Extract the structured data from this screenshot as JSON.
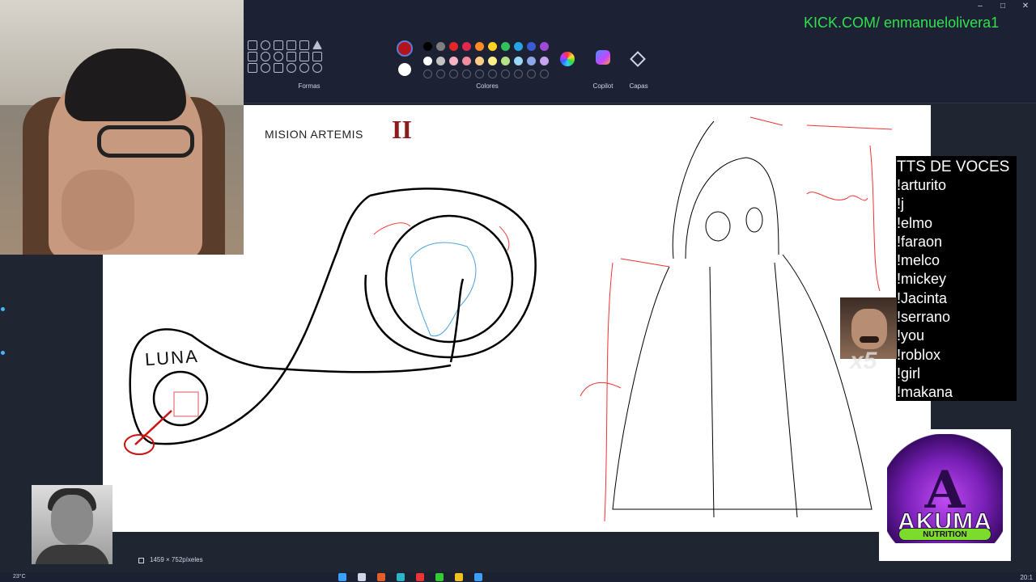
{
  "ribbon": {
    "groups": {
      "shapes_label": "Formas",
      "colors_label": "Colores",
      "copilot_label": "Copilot",
      "layers_label": "Capas"
    },
    "current_color": "#b3141c",
    "secondary_color": "#ffffff",
    "palette_row1": [
      "#000000",
      "#7f7f7f",
      "#e4262b",
      "#e3264f",
      "#ff8a26",
      "#ffd21f",
      "#33c15a",
      "#27a4e3",
      "#3b5bd6",
      "#a24ad8"
    ],
    "palette_row2": [
      "#ffffff",
      "#c3c3c3",
      "#f6b3c4",
      "#f48ba0",
      "#ffcf8a",
      "#fff08a",
      "#b6e38a",
      "#9bd8f4",
      "#8fa6e8",
      "#c9a4ee"
    ],
    "window_controls": [
      "–",
      "□",
      "✕"
    ]
  },
  "overlay": {
    "kick_channel": "KICK.COM/ enmanuelolivera1",
    "tts_title": "TTS DE VOCES",
    "tts_commands": [
      "!arturito",
      "!j",
      "!elmo",
      "!faraon",
      "!melco",
      "!mickey",
      "!Jacinta",
      "!serrano",
      "!you",
      "!roblox",
      "!girl",
      "!makana"
    ],
    "emote_count": "x5",
    "sponsor_letter": "A",
    "sponsor_brand": "AKUMA",
    "sponsor_tag": "NUTRITION"
  },
  "canvas": {
    "title": "MISION ARTEMIS",
    "roman_numeral": "II",
    "moon_label": "LUNA"
  },
  "status": {
    "canvas_size": "1459 × 752píxeles"
  },
  "taskbar": {
    "weather": "23°C",
    "clock": "20:1"
  }
}
